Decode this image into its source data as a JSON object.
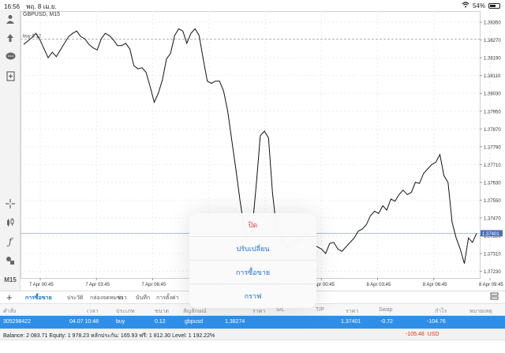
{
  "status_bar": {
    "time": "16:56",
    "date": "พฤ. 8 เม.ย.",
    "battery": "54%",
    "battery_level": 0.54,
    "wifi_icon": "wifi-icon"
  },
  "toolbar": {
    "icons": [
      "person-icon",
      "trade-icon",
      "chat-icon",
      "document-icon",
      "crosshair-icon",
      "candles-icon",
      "function-icon",
      "objects-icon"
    ],
    "timeframe": "M15"
  },
  "chart_data": {
    "type": "line",
    "title": "GBPUSD, M15",
    "x": [
      "7 Apr 00:45",
      "7 Apr 03:45",
      "7 Apr 06:45",
      "7 Apr 09:45",
      "7 Apr 21:45",
      "8 Apr 00:45",
      "8 Apr 03:45",
      "8 Apr 06:45",
      "8 Apr 09:45"
    ],
    "y_ticks": [
      "1.38350",
      "1.38270",
      "1.38190",
      "1.38110",
      "1.38030",
      "1.37950",
      "1.37870",
      "1.37790",
      "1.37710",
      "1.37630",
      "1.37550",
      "1.37470",
      "1.37390",
      "1.37310",
      "1.37230"
    ],
    "ylim": [
      1.372,
      1.384
    ],
    "series": [
      {
        "values": [
          1.3825,
          1.38265,
          1.3828,
          1.383,
          1.3827,
          1.3823,
          1.3819,
          1.38215,
          1.38195,
          1.38225,
          1.38255,
          1.38285,
          1.383,
          1.3831,
          1.38285,
          1.38275,
          1.3825,
          1.38235,
          1.38225,
          1.38275,
          1.383,
          1.3829,
          1.3827,
          1.38245,
          1.38245,
          1.38255,
          1.3823,
          1.38155,
          1.3814,
          1.38145,
          1.38125,
          1.3806,
          1.3799,
          1.3803,
          1.3809,
          1.38185,
          1.3821,
          1.3829,
          1.3832,
          1.3831,
          1.38255,
          1.383,
          1.3832,
          1.3829,
          1.38185,
          1.38085,
          1.38075,
          1.38085,
          1.38085,
          1.3804,
          1.3795,
          1.3782,
          1.3769,
          1.3755,
          1.3743,
          1.3738,
          1.3742,
          1.3762,
          1.3784,
          1.3786,
          1.3783,
          1.3758,
          1.3742,
          1.3739,
          1.3735,
          1.3733,
          1.3737,
          1.3736,
          1.3739,
          1.374,
          1.3739,
          1.3735,
          1.3734,
          1.3733,
          1.3731,
          1.37355,
          1.3736,
          1.3733,
          1.3732,
          1.3734,
          1.3736,
          1.3738,
          1.3741,
          1.3742,
          1.3744,
          1.3748,
          1.375,
          1.3749,
          1.37525,
          1.37505,
          1.37555,
          1.37545,
          1.37575,
          1.37595,
          1.37575,
          1.37585,
          1.3763,
          1.37625,
          1.3767,
          1.3769,
          1.3771,
          1.3772,
          1.37755,
          1.3766,
          1.3763,
          1.3745,
          1.3738,
          1.3733,
          1.37265,
          1.3738,
          1.3736,
          1.37401
        ]
      }
    ],
    "current_price": "1.37401",
    "current_value": 1.37401,
    "buy_line_label": "buy 0.12",
    "buy_line_value": 1.38274,
    "grid": true
  },
  "tabs": [
    "การซื้อขาย",
    "ประวัติ",
    "กล่องจดหมาย",
    "ข่าว",
    "บันทึก",
    "การตั้งค่า"
  ],
  "active_tab": 0,
  "table": {
    "headers": [
      "คำสั่ง",
      "เวลา",
      "ประเภท",
      "ขนาด",
      "สัญลักษณ์",
      "ราคา",
      "S/L",
      "T/P",
      "ราคา",
      "Swap",
      "กำไร",
      "หมายเหตุ"
    ],
    "row": {
      "order": "305298422",
      "time": "04.07 10:48",
      "type": "buy",
      "size": "0.12",
      "symbol": "gbpusd",
      "price": "1.38274",
      "current_price": "1.37401",
      "swap": "-0.72",
      "profit": "-104.76"
    }
  },
  "balance_bar": {
    "text": "Balance: 2 083.71 Equity: 1 978.23 หลักประกัน: 165.93 ฟรี: 1 812.30 Level: 1 192.22%",
    "total_profit": "-105.48",
    "currency": "USD"
  },
  "action_sheet": {
    "items": [
      "ปิด",
      "ปรับเปลี่ยน",
      "การซื้อขาย",
      "กราฟ"
    ]
  }
}
